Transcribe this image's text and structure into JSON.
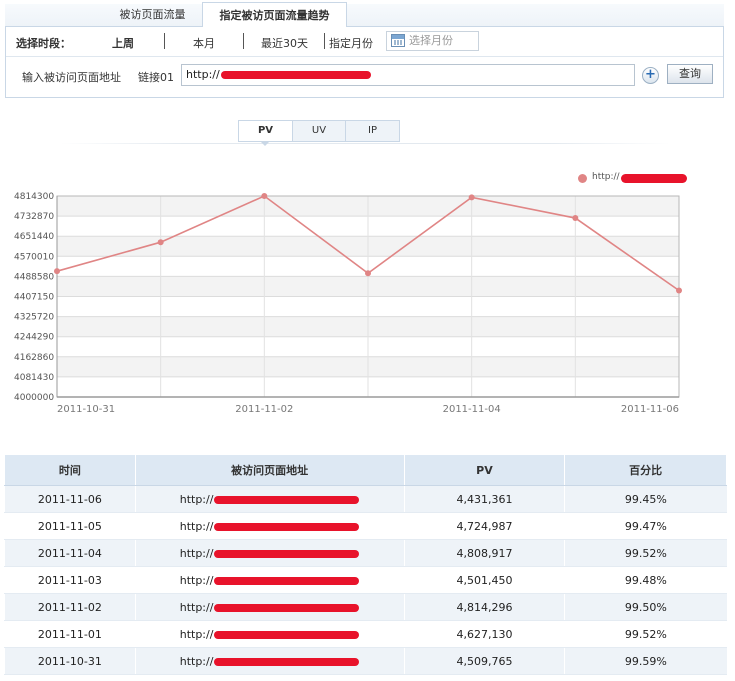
{
  "tabs": [
    {
      "label": "被访页面流量"
    },
    {
      "label": "指定被访页面流量趋势"
    }
  ],
  "filter": {
    "period_label": "选择时段：",
    "options": [
      "上周",
      "本月",
      "最近30天",
      "指定月份"
    ],
    "month_placeholder": "选择月份",
    "url_label": "输入被访问页面地址",
    "link_label": "链接01",
    "url_value": "http://",
    "query_button": "查询",
    "add_button": "+"
  },
  "metric_tabs": [
    "PV",
    "UV",
    "IP"
  ],
  "legend": {
    "series_label": "http://"
  },
  "colors": {
    "series": "#e08585",
    "header_bg": "#dde8f3",
    "row_alt": "#eef3f8"
  },
  "chart_data": {
    "type": "line",
    "x": [
      "2011-10-31",
      "2011-11-01",
      "2011-11-02",
      "2011-11-03",
      "2011-11-04",
      "2011-11-05",
      "2011-11-06"
    ],
    "x_tick_labels": [
      "2011-10-31",
      "2011-11-02",
      "2011-11-04",
      "2011-11-06"
    ],
    "series": [
      {
        "name": "http://",
        "values": [
          4509765,
          4627130,
          4814296,
          4501450,
          4808917,
          4724987,
          4431361
        ]
      }
    ],
    "y_ticks": [
      4000000,
      4081430,
      4162860,
      4244290,
      4325720,
      4407150,
      4488580,
      4570010,
      4651440,
      4732870,
      4814300
    ],
    "ylim": [
      4000000,
      4814300
    ],
    "grid": true,
    "legend_position": "top-right"
  },
  "table": {
    "headers": [
      "时间",
      "被访问页面地址",
      "PV",
      "百分比"
    ],
    "rows": [
      {
        "date": "2011-11-06",
        "url": "http://",
        "pv": "4,431,361",
        "pct": "99.45%"
      },
      {
        "date": "2011-11-05",
        "url": "http://",
        "pv": "4,724,987",
        "pct": "99.47%"
      },
      {
        "date": "2011-11-04",
        "url": "http://",
        "pv": "4,808,917",
        "pct": "99.52%"
      },
      {
        "date": "2011-11-03",
        "url": "http://",
        "pv": "4,501,450",
        "pct": "99.48%"
      },
      {
        "date": "2011-11-02",
        "url": "http://",
        "pv": "4,814,296",
        "pct": "99.50%"
      },
      {
        "date": "2011-11-01",
        "url": "http://",
        "pv": "4,627,130",
        "pct": "99.52%"
      },
      {
        "date": "2011-10-31",
        "url": "http://",
        "pv": "4,509,765",
        "pct": "99.59%"
      }
    ]
  }
}
